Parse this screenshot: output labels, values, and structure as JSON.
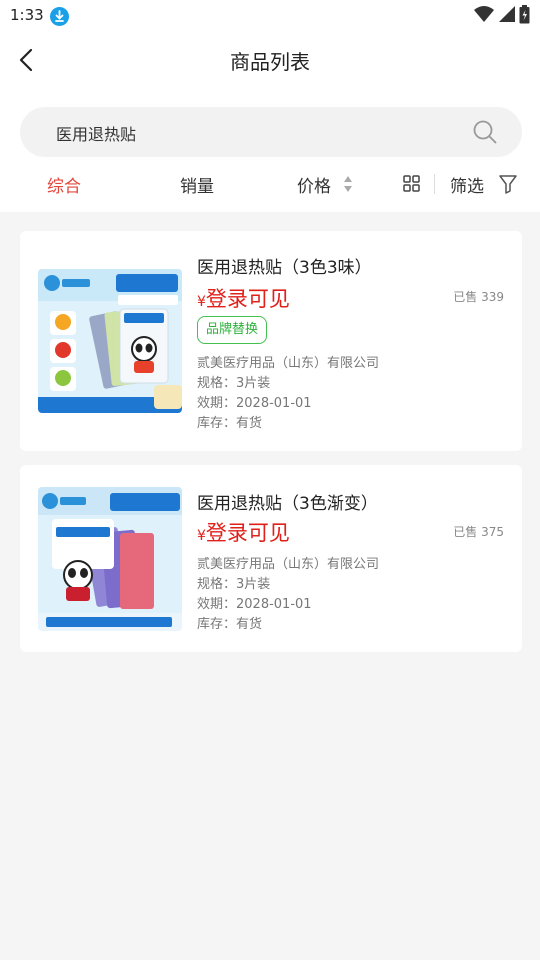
{
  "status_bar": {
    "time": "1:33"
  },
  "header": {
    "title": "商品列表"
  },
  "search": {
    "query": "医用退热贴"
  },
  "sort": {
    "overall": "综合",
    "sales": "销量",
    "price": "价格",
    "filter": "筛选"
  },
  "products": [
    {
      "name": "医用退热贴（3色3味）",
      "price_symbol": "¥",
      "price_text": "登录可见",
      "sold": "已售 339",
      "tag": "品牌替换",
      "company": "贰美医疗用品（山东）有限公司",
      "spec": "规格：3片装",
      "expiry": "效期：2028-01-01",
      "stock": "库存：有货"
    },
    {
      "name": "医用退热贴（3色渐变）",
      "price_symbol": "¥",
      "price_text": "登录可见",
      "sold": "已售 375",
      "company": "贰美医疗用品（山东）有限公司",
      "spec": "规格：3片装",
      "expiry": "效期：2028-01-01",
      "stock": "库存：有货"
    }
  ],
  "colors": {
    "accent": "#e0463d",
    "price": "#e0201a",
    "tag": "#2fb13c"
  }
}
